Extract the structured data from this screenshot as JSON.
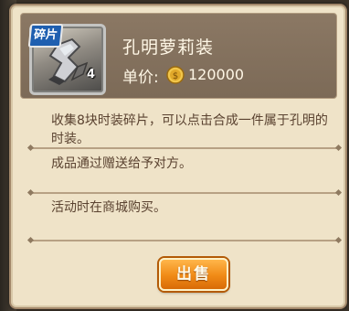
{
  "item": {
    "badge_label": "碎片",
    "count": "4",
    "name": "孔明萝莉装",
    "price_label": "单价:",
    "price_value": "120000",
    "currency_icon": "silver-coin-icon"
  },
  "descriptions": [
    "收集8块时装碎片，可以点击合成一件属于孔明的时装。",
    "成品通过赠送给予对方。",
    "活动时在商城购买。"
  ],
  "actions": {
    "sell_label": "出售"
  },
  "colors": {
    "panel_bg": "#efe3c8",
    "header_bg": "#7c6a57",
    "text_brown": "#5a4230",
    "button_orange": "#f08a16",
    "badge_blue": "#1f5fb0"
  }
}
